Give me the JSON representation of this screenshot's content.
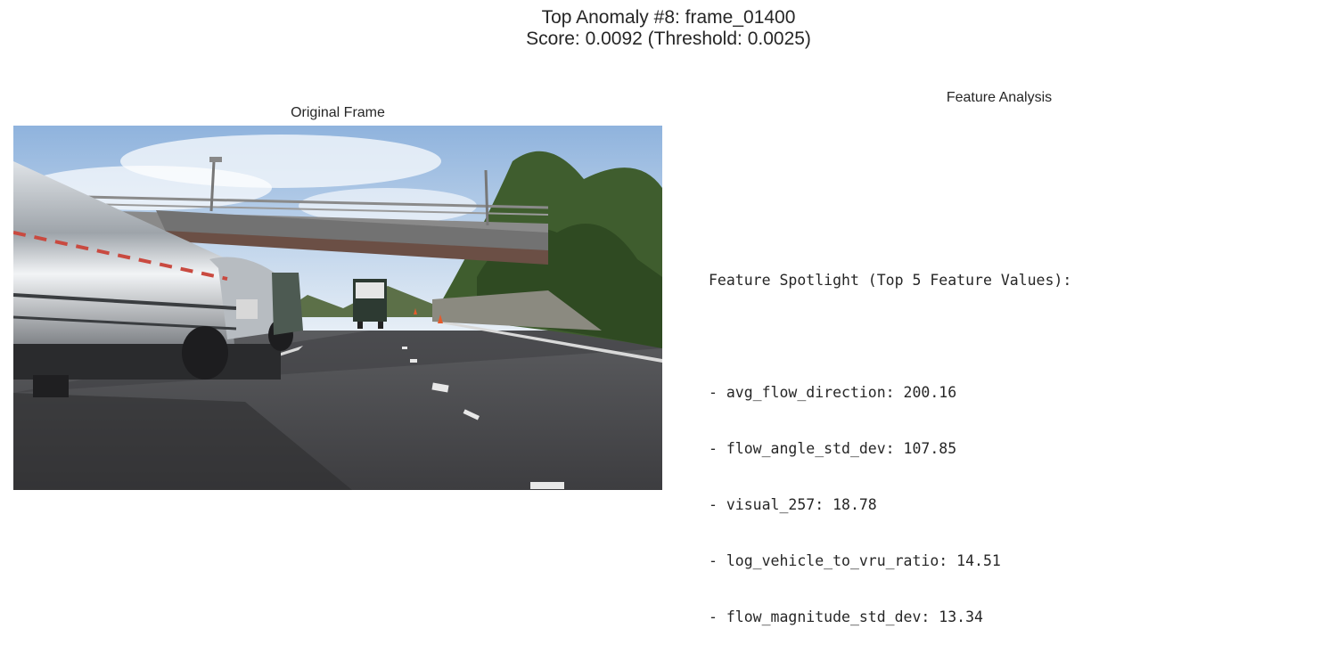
{
  "figure": {
    "title_line1": "Top Anomaly #8: frame_01400",
    "title_line2": "Score: 0.0092 (Threshold: 0.0025)"
  },
  "left_panel": {
    "title": "Original Frame"
  },
  "right_panel": {
    "title": "Feature Analysis",
    "heading": "Feature Spotlight (Top 5 Feature Values):",
    "features": [
      "- avg_flow_direction: 200.16",
      "- flow_angle_std_dev: 107.85",
      "- visual_257: 18.78",
      "- log_vehicle_to_vru_ratio: 14.51",
      "- flow_magnitude_std_dev: 13.34"
    ]
  },
  "colors": {
    "sky": "#b9d3ee",
    "road": "#4a4a4c",
    "foliage": "#3d5a2c",
    "tanker": "#a9aeb4",
    "bridge": "#6c6c6c"
  }
}
